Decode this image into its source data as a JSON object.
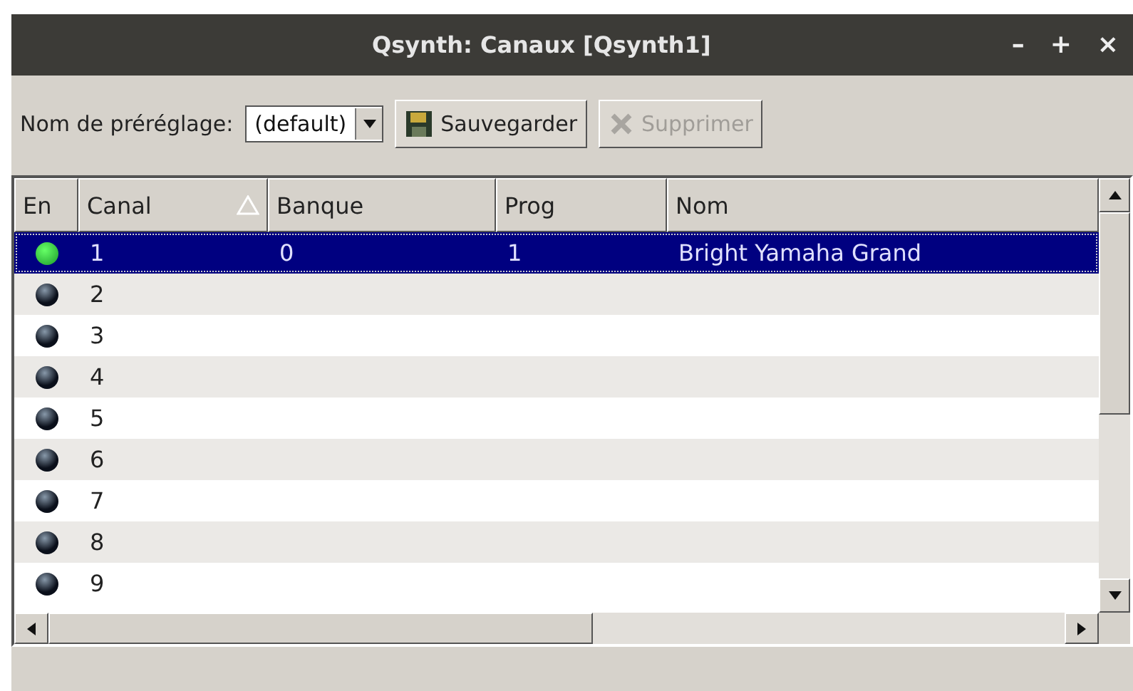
{
  "window": {
    "title": "Qsynth: Canaux [Qsynth1]",
    "controls": [
      "–",
      "+",
      "×"
    ]
  },
  "toolbar": {
    "preset_label": "Nom de préréglage:",
    "preset_value": "(default)",
    "save_button": {
      "label": "Sauvegarder",
      "disabled": false
    },
    "delete_button": {
      "label": "Supprimer",
      "disabled": true
    }
  },
  "table": {
    "columns": [
      {
        "label": "En",
        "sorted": false
      },
      {
        "label": "Canal",
        "sorted": true
      },
      {
        "label": "Banque",
        "sorted": false
      },
      {
        "label": "Prog",
        "sorted": false
      },
      {
        "label": "Nom",
        "sorted": false
      }
    ],
    "rows": [
      {
        "enabled": true,
        "selected": true,
        "canal": "1",
        "banque": "0",
        "prog": "1",
        "nom": "Bright Yamaha Grand"
      },
      {
        "enabled": false,
        "selected": false,
        "canal": "2"
      },
      {
        "enabled": false,
        "selected": false,
        "canal": "3"
      },
      {
        "enabled": false,
        "selected": false,
        "canal": "4"
      },
      {
        "enabled": false,
        "selected": false,
        "canal": "5"
      },
      {
        "enabled": false,
        "selected": false,
        "canal": "6"
      },
      {
        "enabled": false,
        "selected": false,
        "canal": "7"
      },
      {
        "enabled": false,
        "selected": false,
        "canal": "8"
      },
      {
        "enabled": false,
        "selected": false,
        "canal": "9"
      }
    ]
  }
}
